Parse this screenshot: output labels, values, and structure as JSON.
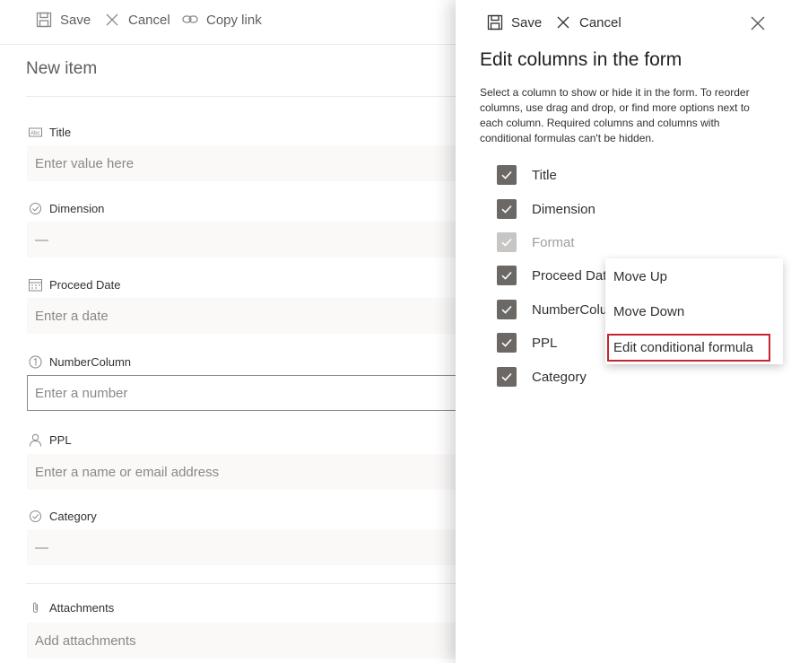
{
  "form": {
    "toolbar": {
      "save_label": "Save",
      "cancel_label": "Cancel",
      "copy_link_label": "Copy link"
    },
    "title": "New item",
    "fields": [
      {
        "label": "Title",
        "placeholder": "Enter value here",
        "icon": "text-field-icon"
      },
      {
        "label": "Dimension",
        "placeholder": "—",
        "icon": "choice-icon"
      },
      {
        "label": "Proceed Date",
        "placeholder": "Enter a date",
        "icon": "calendar-icon"
      },
      {
        "label": "NumberColumn",
        "placeholder": "Enter a number",
        "icon": "number-icon"
      },
      {
        "label": "PPL",
        "placeholder": "Enter a name or email address",
        "icon": "person-icon"
      },
      {
        "label": "Category",
        "placeholder": "—",
        "icon": "choice-icon"
      },
      {
        "label": "Attachments",
        "placeholder": "Add attachments",
        "icon": "paperclip-icon"
      }
    ]
  },
  "panel": {
    "toolbar": {
      "save_label": "Save",
      "cancel_label": "Cancel"
    },
    "title": "Edit columns in the form",
    "description": "Select a column to show or hide it in the form. To reorder columns, use drag and drop, or find more options next to each column. Required columns and columns with conditional formulas can't be hidden.",
    "columns": [
      {
        "label": "Title",
        "checked": true,
        "disabled": false
      },
      {
        "label": "Dimension",
        "checked": true,
        "disabled": false
      },
      {
        "label": "Format",
        "checked": true,
        "disabled": true
      },
      {
        "label": "Proceed Dat",
        "checked": true,
        "disabled": false
      },
      {
        "label": "NumberColu",
        "checked": true,
        "disabled": false
      },
      {
        "label": "PPL",
        "checked": true,
        "disabled": false
      },
      {
        "label": "Category",
        "checked": true,
        "disabled": false
      }
    ]
  },
  "context_menu": {
    "items": [
      "Move Up",
      "Move Down",
      "Edit conditional formula"
    ],
    "highlighted": "Edit conditional formula",
    "highlight_color": "#c4262e"
  },
  "colors": {
    "checkbox": "#6b6866",
    "checkbox_disabled": "#c8c6c4",
    "field_bg": "#faf9f8"
  }
}
